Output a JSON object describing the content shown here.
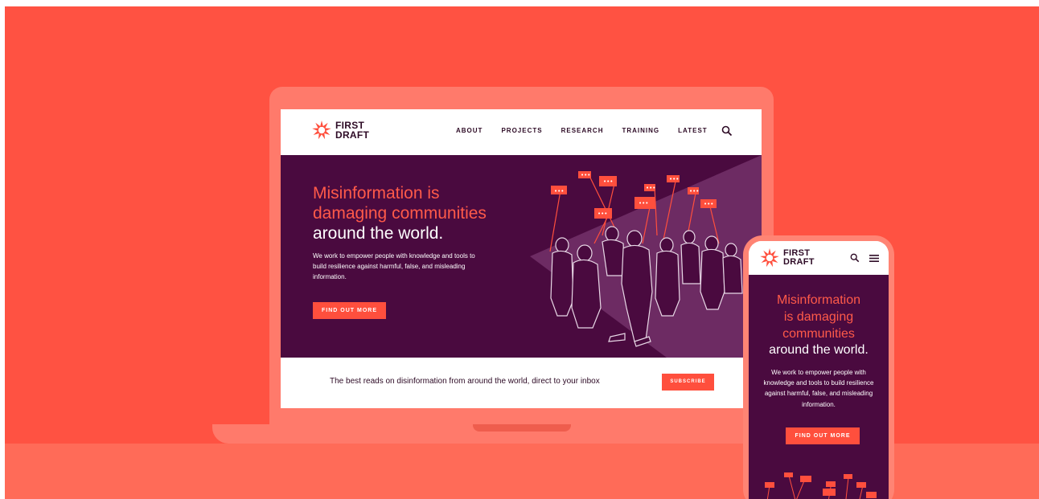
{
  "colors": {
    "background": "#ff5242",
    "device": "#ff7a6b",
    "hero_bg": "#4a0a3f",
    "accent": "#ff4f3d",
    "heading_accent": "#ff5a49",
    "text_dark": "#2d0a25"
  },
  "logo": {
    "line1": "FIRST",
    "line2": "DRAFT",
    "icon": "first-draft-burst-logo"
  },
  "nav": {
    "items": [
      "ABOUT",
      "PROJECTS",
      "RESEARCH",
      "TRAINING",
      "LATEST"
    ],
    "search_icon": "search-icon",
    "menu_icon": "hamburger-menu-icon"
  },
  "hero": {
    "heading_line1": "Misinformation is",
    "heading_line2": "damaging communities",
    "heading_line3": "around the world.",
    "mobile_heading_line1": "Misinformation",
    "mobile_heading_line2": "is damaging",
    "mobile_heading_line3": "communities",
    "mobile_heading_line4": "around the world.",
    "body": "We work to empower people with knowledge and tools to build resilience against harmful, false, and misleading information.",
    "cta": "FIND OUT MORE"
  },
  "newsletter": {
    "text": "The best reads on disinformation from around the world, direct to your inbox",
    "button": "SUBSCRIBE"
  }
}
